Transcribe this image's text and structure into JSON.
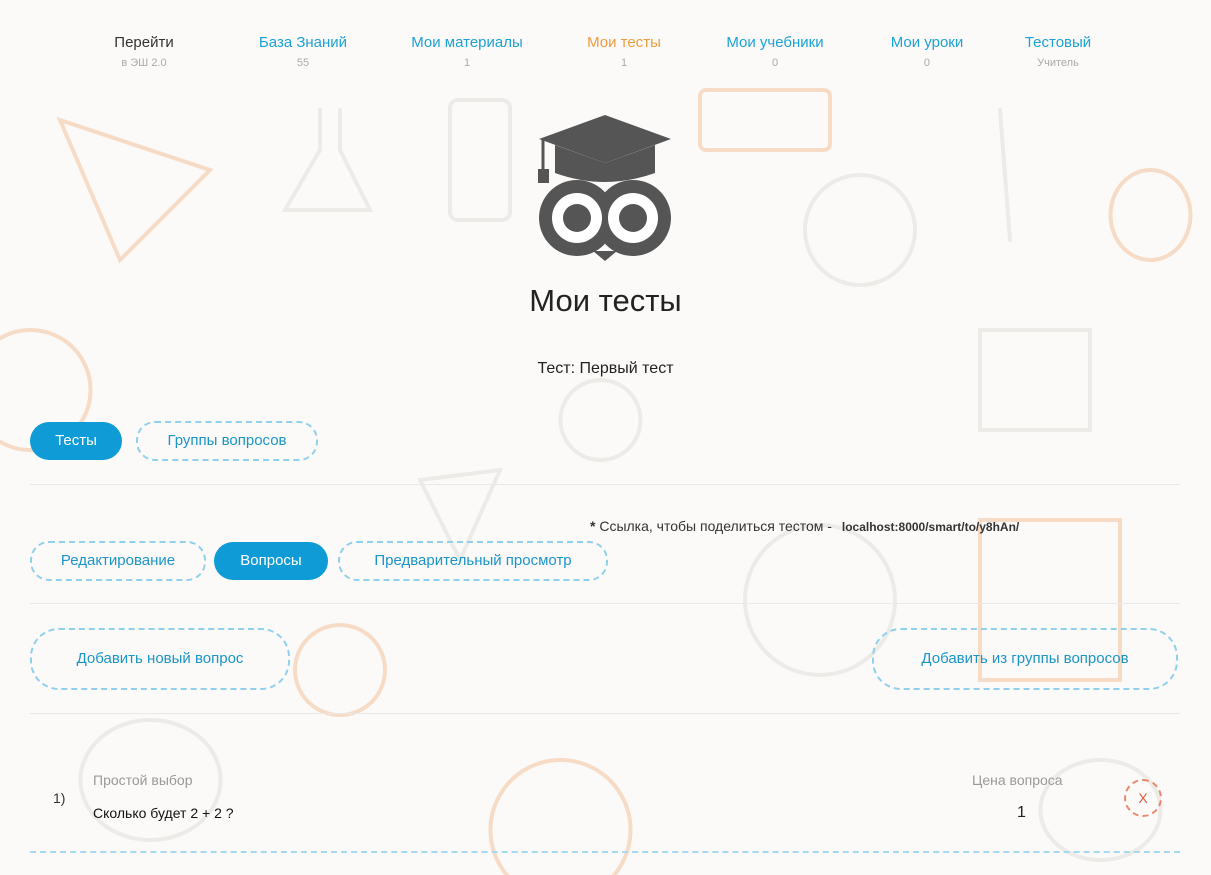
{
  "nav": [
    {
      "label": "Перейти",
      "sub": "в ЭШ 2.0"
    },
    {
      "label": "База Знаний",
      "sub": "55"
    },
    {
      "label": "Мои материалы",
      "sub": "1"
    },
    {
      "label": "Мои тесты",
      "sub": "1"
    },
    {
      "label": "Мои учебники",
      "sub": "0"
    },
    {
      "label": "Мои уроки",
      "sub": "0"
    },
    {
      "label": "Тестовый",
      "sub": "Учитель"
    }
  ],
  "logo_icon": "owl-graduation-cap-icon",
  "page_title": "Мои тесты",
  "test_title": "Тест: Первый тест",
  "top_tabs": {
    "tests": "Тесты",
    "question_groups": "Группы вопросов"
  },
  "share": {
    "star": "*",
    "text": "Ссылка, чтобы поделиться тестом -",
    "link": "localhost:8000/smart/to/y8hAn/"
  },
  "sub_tabs": {
    "edit": "Редактирование",
    "questions": "Вопросы",
    "preview": "Предварительный просмотр"
  },
  "actions": {
    "add_new": "Добавить новый вопрос",
    "add_from_group": "Добавить из группы вопросов"
  },
  "questions": [
    {
      "num": "1)",
      "type": "Простой выбор",
      "text": "Сколько будет 2 + 2 ?",
      "price_label": "Цена вопроса",
      "price": "1",
      "delete": "X"
    }
  ],
  "colors": {
    "accent": "#0e9bd6",
    "active_nav": "#f09a3e",
    "delete": "#e05a3a",
    "dashed": "#8fd0ec"
  }
}
